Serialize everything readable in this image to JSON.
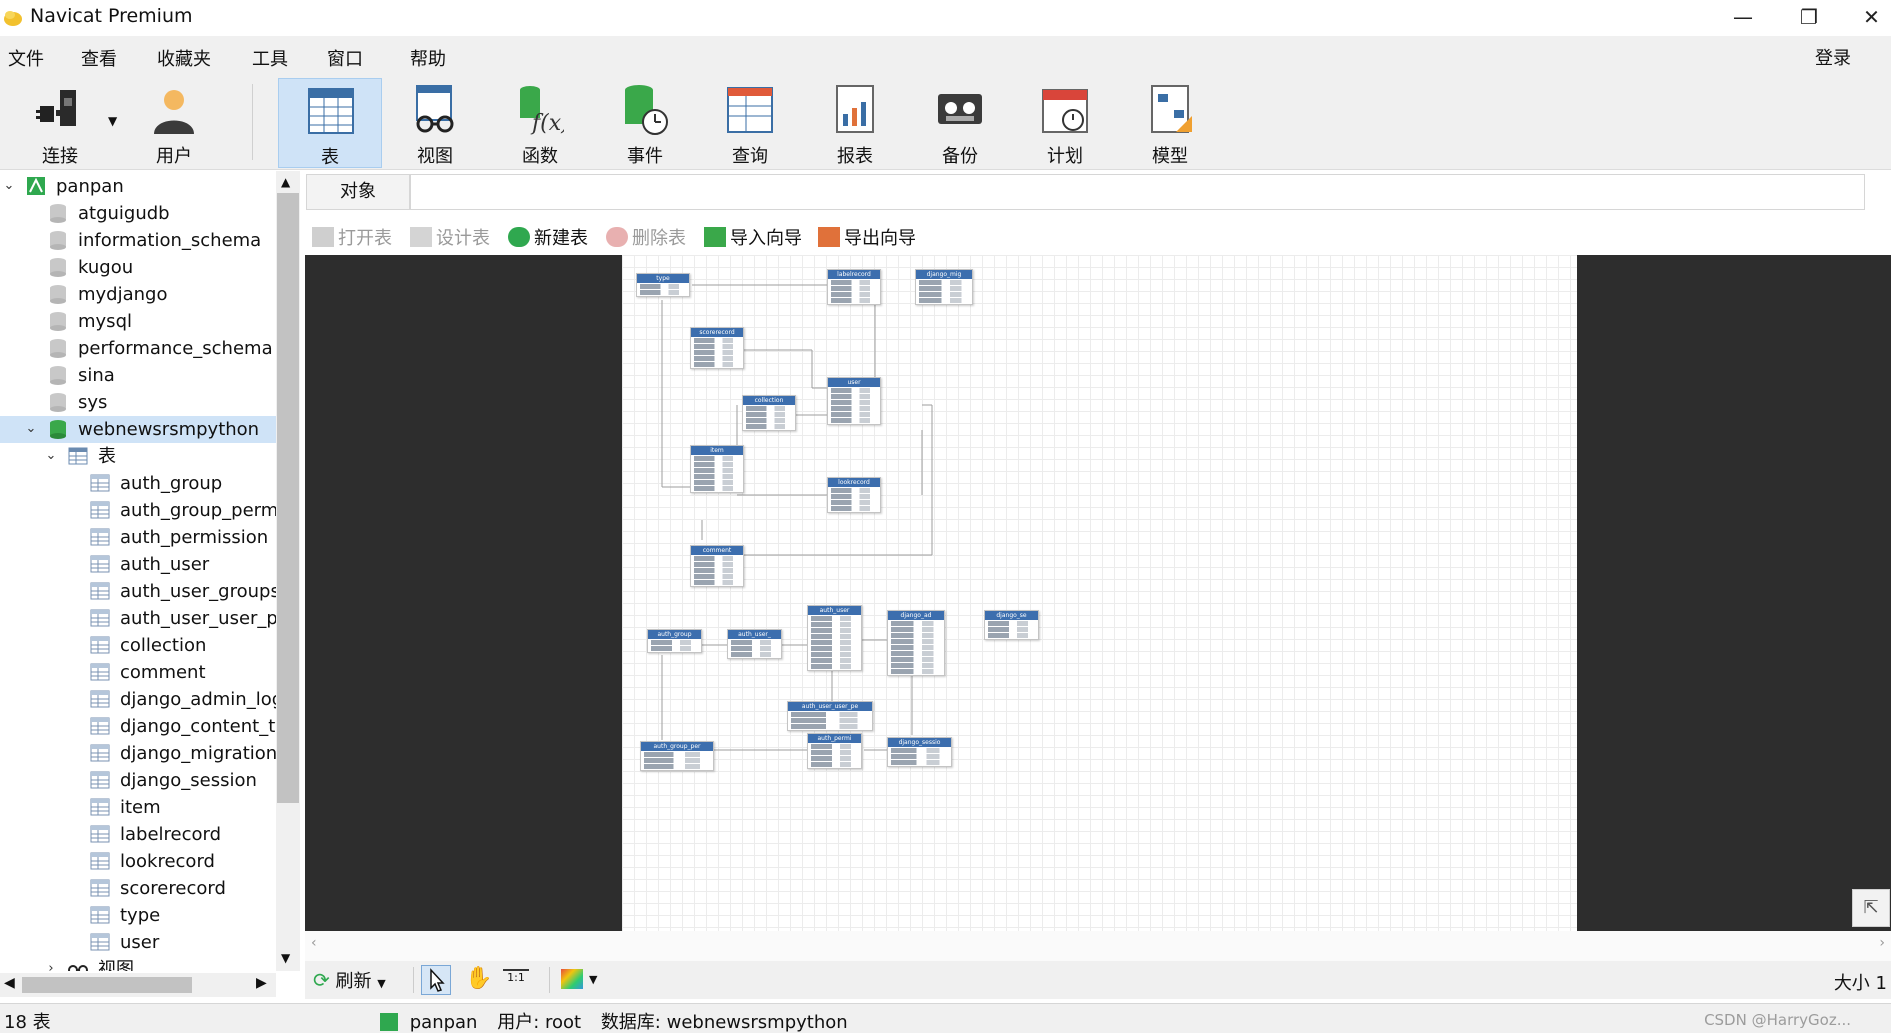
{
  "window": {
    "title": "Navicat Premium"
  },
  "menu": {
    "items": [
      "文件",
      "查看",
      "收藏夹",
      "工具",
      "窗口",
      "帮助"
    ],
    "login": "登录"
  },
  "toolbar": {
    "items": [
      {
        "label": "连接",
        "icon": "plug-icon"
      },
      {
        "label": "用户",
        "icon": "user-icon"
      },
      {
        "label": "表",
        "icon": "table-icon",
        "active": true
      },
      {
        "label": "视图",
        "icon": "view-icon"
      },
      {
        "label": "函数",
        "icon": "function-icon"
      },
      {
        "label": "事件",
        "icon": "event-icon"
      },
      {
        "label": "查询",
        "icon": "query-icon"
      },
      {
        "label": "报表",
        "icon": "report-icon"
      },
      {
        "label": "备份",
        "icon": "backup-icon"
      },
      {
        "label": "计划",
        "icon": "schedule-icon"
      },
      {
        "label": "模型",
        "icon": "model-icon"
      }
    ]
  },
  "tree": {
    "connection": "panpan",
    "databases": [
      "atguigudb",
      "information_schema",
      "kugou",
      "mydjango",
      "mysql",
      "performance_schema",
      "sina",
      "sys"
    ],
    "active_db": "webnewsrsmpython",
    "tables_folder": "表",
    "tables": [
      "auth_group",
      "auth_group_perm",
      "auth_permission",
      "auth_user",
      "auth_user_groups",
      "auth_user_user_pe",
      "collection",
      "comment",
      "django_admin_log",
      "django_content_ty",
      "django_migration",
      "django_session",
      "item",
      "labelrecord",
      "lookrecord",
      "scorerecord",
      "type",
      "user"
    ],
    "views_folder": "视图"
  },
  "objects_tab": "对象",
  "actions": [
    {
      "label": "打开表",
      "icon": "open-table-icon",
      "disabled": true
    },
    {
      "label": "设计表",
      "icon": "design-table-icon",
      "disabled": true
    },
    {
      "label": "新建表",
      "icon": "new-table-icon",
      "disabled": false
    },
    {
      "label": "删除表",
      "icon": "delete-table-icon",
      "disabled": true
    },
    {
      "label": "导入向导",
      "icon": "import-wizard-icon",
      "disabled": false
    },
    {
      "label": "导出向导",
      "icon": "export-wizard-icon",
      "disabled": false
    }
  ],
  "er_tables": [
    "type",
    "labelrecord",
    "django_mig",
    "scorerecord",
    "user",
    "collection",
    "item",
    "lookrecord",
    "comment",
    "auth_user",
    "auth_group",
    "auth_user_",
    "django_ad",
    "django_se",
    "auth_user_user_pe",
    "auth_group_per",
    "auth_permi",
    "django_sessio"
  ],
  "bottom": {
    "refresh": "刷新",
    "size": "大小 1"
  },
  "status": {
    "count": "18 表",
    "connection": "panpan",
    "user": "用户: root",
    "database": "数据库: webnewsrsmpython",
    "watermark": "CSDN @HarryGoz..."
  },
  "colors": {
    "accent": "#3c6eae",
    "selection": "#cfe3f7",
    "db_active": "#3aa84a"
  }
}
